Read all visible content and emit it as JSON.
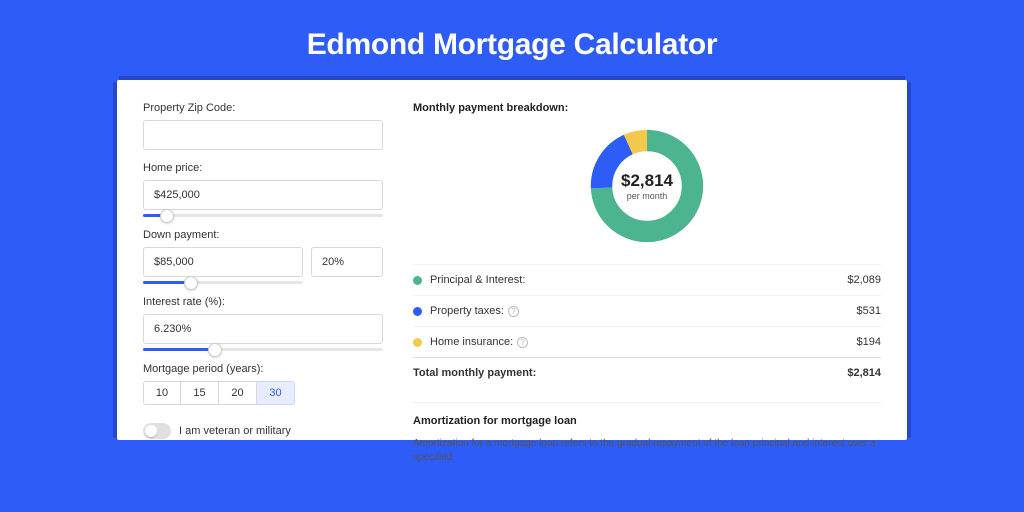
{
  "page_title": "Edmond Mortgage Calculator",
  "form": {
    "zip_label": "Property Zip Code:",
    "zip_value": "",
    "home_price_label": "Home price:",
    "home_price_value": "$425,000",
    "home_price_slider_pct": 10,
    "down_label": "Down payment:",
    "down_value": "$85,000",
    "down_pct": "20%",
    "down_slider_pct": 20,
    "rate_label": "Interest rate (%):",
    "rate_value": "6.230%",
    "rate_slider_pct": 30,
    "period_label": "Mortgage period (years):",
    "periods": [
      "10",
      "15",
      "20",
      "30"
    ],
    "period_selected": "30",
    "veteran_label": "I am veteran or military"
  },
  "breakdown": {
    "title": "Monthly payment breakdown:",
    "total_amount": "$2,814",
    "per_month": "per month",
    "items": [
      {
        "label": "Principal & Interest:",
        "value": "$2,089",
        "color": "#4cb58f",
        "pct": 74.2,
        "help": false
      },
      {
        "label": "Property taxes:",
        "value": "$531",
        "color": "#2e5cf6",
        "pct": 18.9,
        "help": true
      },
      {
        "label": "Home insurance:",
        "value": "$194",
        "color": "#f3c94b",
        "pct": 6.9,
        "help": true
      }
    ],
    "total_label": "Total monthly payment:",
    "total_value": "$2,814"
  },
  "amortization": {
    "title": "Amortization for mortgage loan",
    "text": "Amortization for a mortgage loan refers to the gradual repayment of the loan principal and interest over a specified"
  },
  "chart_data": {
    "type": "pie",
    "title": "Monthly payment breakdown",
    "series": [
      {
        "name": "Principal & Interest",
        "value": 2089,
        "color": "#4cb58f"
      },
      {
        "name": "Property taxes",
        "value": 531,
        "color": "#2e5cf6"
      },
      {
        "name": "Home insurance",
        "value": 194,
        "color": "#f3c94b"
      }
    ],
    "total": 2814,
    "center_label": "$2,814 per month"
  }
}
